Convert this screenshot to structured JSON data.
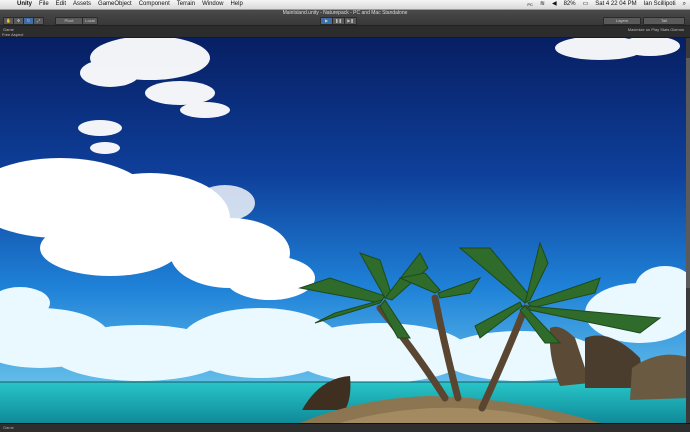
{
  "menubar": {
    "apple": "",
    "items": [
      "Unity",
      "File",
      "Edit",
      "Assets",
      "GameObject",
      "Component",
      "Terrain",
      "Window",
      "Help"
    ],
    "status": {
      "aux": "PC",
      "battery": "82%",
      "datetime": "Sat 4 22 04 PM",
      "user": "Ian Scillipoti"
    }
  },
  "toolbar": {
    "window_title": "MainIsland.unity - Naturepack - PC and Mac Standalone",
    "pivot_label": "Pivot",
    "local_label": "Local",
    "layers_label": "Layers",
    "layout_label": "Tall"
  },
  "game_view": {
    "tab_label": "Game",
    "aspect_label": "Free Aspect",
    "right_label": "Maximize on Play  Stats  Gizmos"
  },
  "bottombar": {
    "text": "Game"
  },
  "colors": {
    "sky_top": "#0a2a7a",
    "sky_mid": "#1a6bd0",
    "sea": "#1fb3b8",
    "sand": "#8c7652"
  }
}
